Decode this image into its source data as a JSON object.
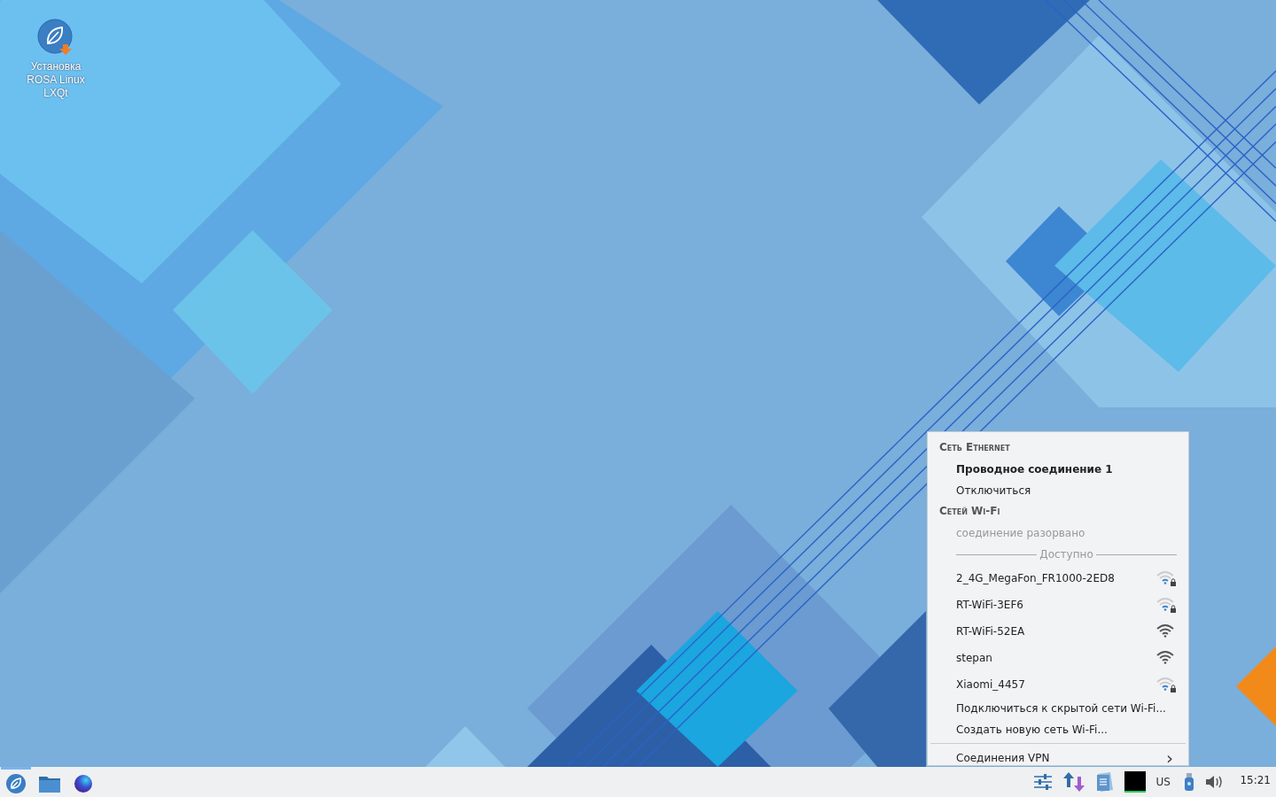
{
  "desktop_icons": [
    {
      "label": "Установка ROSA Linux LXQt"
    }
  ],
  "network_menu": {
    "sections": [
      {
        "title": "Сеть Ethernet",
        "items": [
          {
            "kind": "connection",
            "label": "Проводное соединение 1",
            "active": true
          },
          {
            "kind": "action",
            "label": "Отключиться",
            "active": false
          }
        ]
      },
      {
        "title": "Сетей Wi-Fi",
        "items": [
          {
            "kind": "status",
            "label": "соединение разорвано",
            "disabled": true
          }
        ]
      }
    ],
    "available_label": "Доступно",
    "networks": [
      {
        "name": "2_4G_MegaFon_FR1000-2ED8",
        "full_signal": false,
        "secured": true
      },
      {
        "name": "RT-WiFi-3EF6",
        "full_signal": false,
        "secured": true
      },
      {
        "name": "RT-WiFi-52EA",
        "full_signal": true,
        "secured": false
      },
      {
        "name": "stepan",
        "full_signal": true,
        "secured": false
      },
      {
        "name": "Xiaomi_4457",
        "full_signal": false,
        "secured": true
      }
    ],
    "actions": [
      "Подключиться к скрытой сети Wi-Fi...",
      "Создать новую сеть Wi-Fi..."
    ],
    "submenu": {
      "label": "Соединения VPN",
      "caret": "›"
    }
  },
  "taskbar": {
    "launchers": [
      {
        "kind": "rosa",
        "active": true
      },
      {
        "kind": "folder",
        "active": false
      },
      {
        "kind": "browser",
        "active": false
      }
    ],
    "tray": {
      "keyboard_layout": "US",
      "clock": "15:21"
    }
  }
}
